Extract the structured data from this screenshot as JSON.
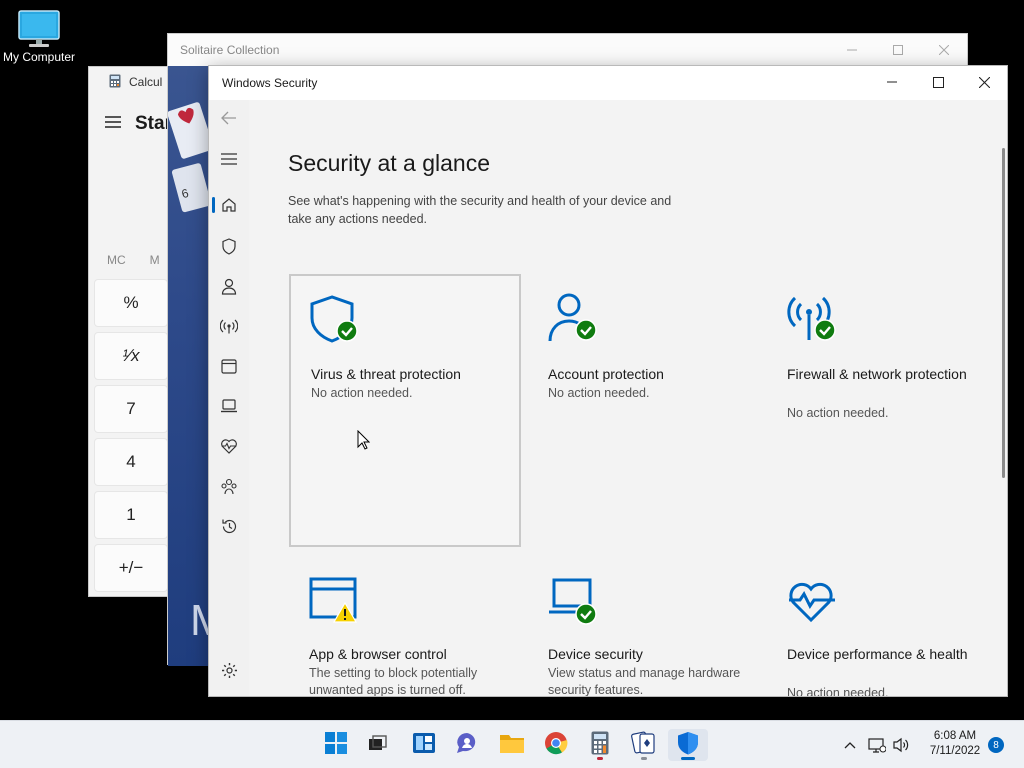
{
  "desktop": {
    "icon_label": "My Computer"
  },
  "calculator": {
    "title": "Calcul",
    "mode": "Star",
    "memory": [
      "MC",
      "M"
    ],
    "keys": [
      "%",
      "¹∕x",
      "7",
      "4",
      "1",
      "+/−"
    ]
  },
  "solitaire": {
    "title": "Solitaire Collection",
    "art_text": "M"
  },
  "security": {
    "window_title": "Windows Security",
    "heading": "Security at a glance",
    "subtitle": "See what's happening with the security and health of your device and take any actions needed.",
    "cards": [
      {
        "title": "Virus & threat protection",
        "status": "No action needed.",
        "icon": "shield-check-icon"
      },
      {
        "title": "Account protection",
        "status": "No action needed.",
        "icon": "person-check-icon"
      },
      {
        "title": "Firewall & network protection",
        "status": "No action needed.",
        "icon": "antenna-check-icon"
      },
      {
        "title": "App & browser control",
        "status": "The setting to block potentially unwanted apps is turned off.",
        "icon": "browser-warning-icon"
      },
      {
        "title": "Device security",
        "status": "View status and manage hardware security features.",
        "icon": "laptop-check-icon"
      },
      {
        "title": "Device performance & health",
        "status": "No action needed.",
        "icon": "heart-pulse-icon"
      }
    ]
  },
  "taskbar": {
    "time": "6:08 AM",
    "date": "7/11/2022",
    "notification_count": "8"
  },
  "colors": {
    "accent": "#0067c0",
    "ok_green": "#107c10",
    "warn_yellow": "#f7d100"
  }
}
